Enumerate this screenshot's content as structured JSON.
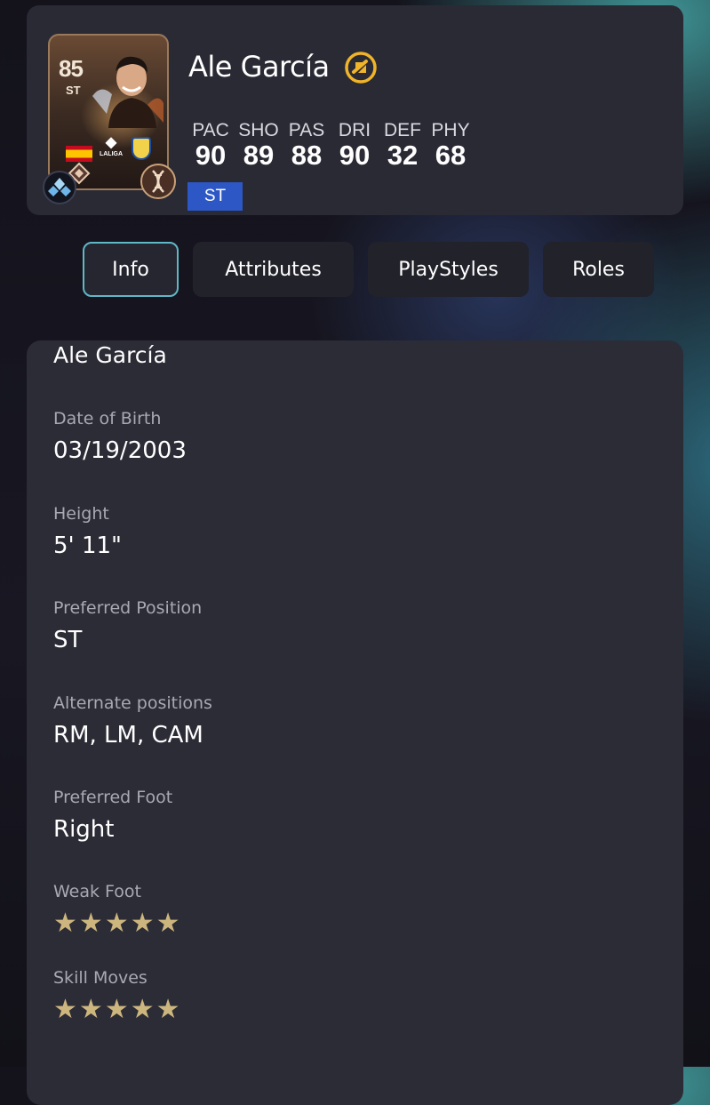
{
  "player": {
    "name": "Ale García",
    "rating": "85",
    "card_position": "ST",
    "league": "LALIGA",
    "stat_labels": [
      "PAC",
      "SHO",
      "PAS",
      "DRI",
      "DEF",
      "PHY"
    ],
    "stat_values": [
      "90",
      "89",
      "88",
      "90",
      "32",
      "68"
    ],
    "position_chip": "ST",
    "icons": {
      "evolution": "evolution-swap-icon",
      "chemistry": "chemistry-diamond-icon",
      "dna": "dna-icon",
      "nation_flag": "spain-flag",
      "club_badge": "las-palmas-badge",
      "rarity_gem": "gem-icon"
    }
  },
  "tabs": [
    {
      "label": "Info",
      "active": true
    },
    {
      "label": "Attributes",
      "active": false
    },
    {
      "label": "PlayStyles",
      "active": false
    },
    {
      "label": "Roles",
      "active": false
    }
  ],
  "info": {
    "name": "Ale García",
    "fields": [
      {
        "label": "Date of Birth",
        "value": "03/19/2003"
      },
      {
        "label": "Height",
        "value": "5' 11\""
      },
      {
        "label": "Preferred Position",
        "value": "ST"
      },
      {
        "label": "Alternate positions",
        "value": "RM, LM, CAM"
      },
      {
        "label": "Preferred Foot",
        "value": "Right"
      }
    ],
    "weak_foot": {
      "label": "Weak Foot",
      "stars": 5,
      "max": 5
    },
    "skill_moves": {
      "label": "Skill Moves",
      "stars": 5,
      "max": 5
    }
  },
  "colors": {
    "accent_tab_border": "#5fb8c6",
    "position_chip": "#2c57c4",
    "star": "#cdb57e",
    "evolution_icon": "#f0b429"
  }
}
